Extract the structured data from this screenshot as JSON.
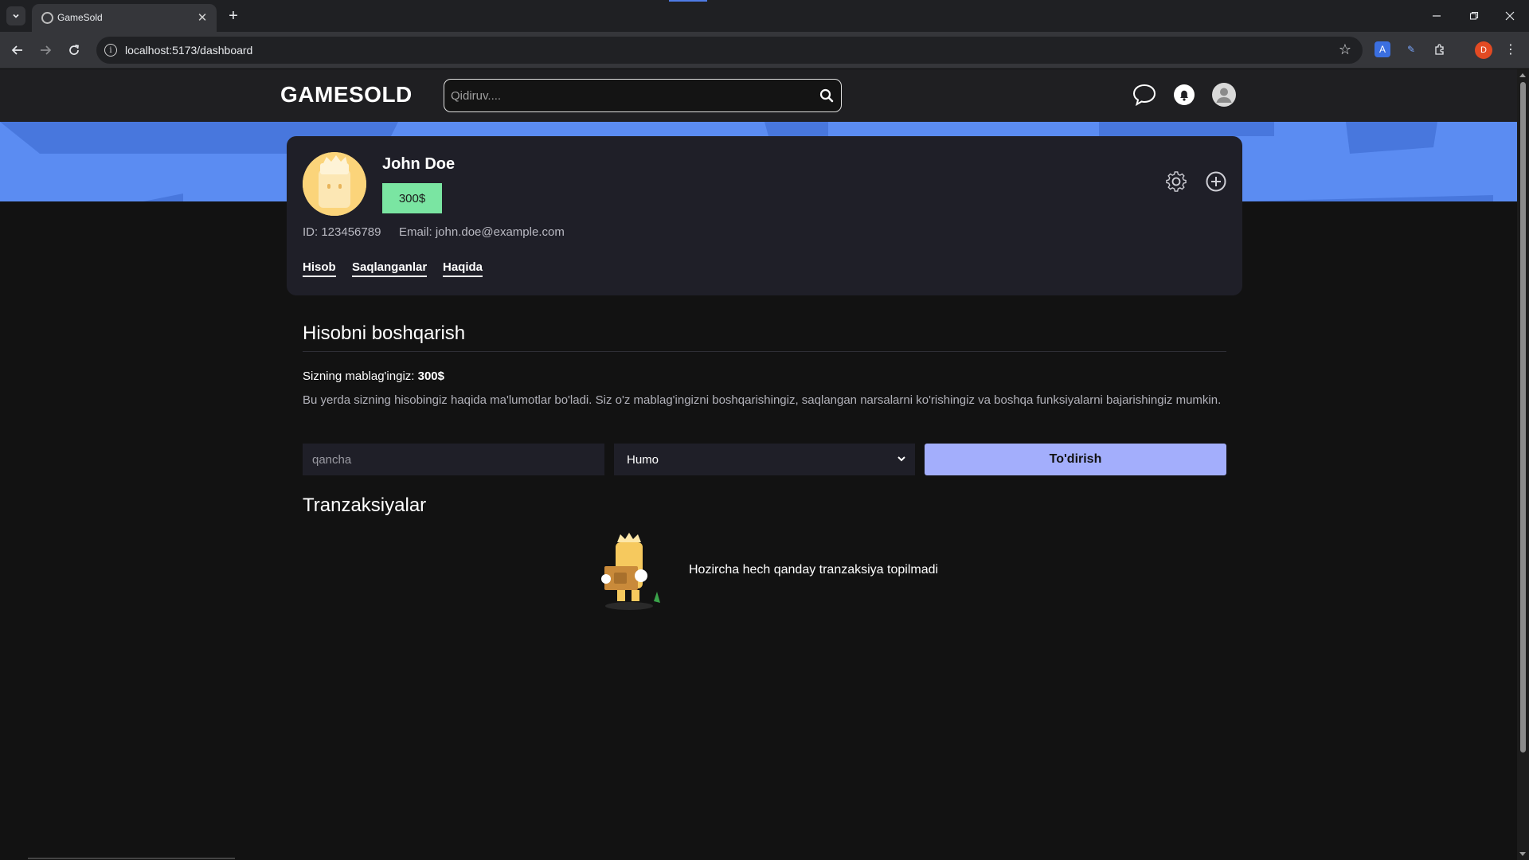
{
  "browser": {
    "tab_title": "GameSold",
    "url": "localhost:5173/dashboard",
    "profile_initial": "D"
  },
  "header": {
    "logo": "GAMESOLD",
    "search_placeholder": "Qidiruv...."
  },
  "profile": {
    "name": "John Doe",
    "balance_badge": "300$",
    "id_text": "ID: 123456789",
    "email_text": "Email: john.doe@example.com",
    "tabs": [
      "Hisob",
      "Saqlanganlar",
      "Haqida"
    ]
  },
  "account": {
    "title": "Hisobni boshqarish",
    "balance_label": "Sizning mablag'ingiz:",
    "balance_value": "300$",
    "description": "Bu yerda sizning hisobingiz haqida ma'lumotlar bo'ladi. Siz o'z mablag'ingizni boshqarishingiz, saqlangan narsalarni ko'rishingiz va boshqa funksiyalarni bajarishingiz mumkin."
  },
  "payment": {
    "amount_placeholder": "qancha",
    "method_selected": "Humo",
    "pay_button": "To'dirish"
  },
  "transactions": {
    "title": "Tranzaksiyalar",
    "empty_text": "Hozircha hech qanday tranzaksiya topilmadi"
  },
  "colors": {
    "banner": "#5b8cf2",
    "card_bg": "#1f1f28",
    "badge": "#7ae5a2",
    "pay_button": "#a3aefc"
  }
}
